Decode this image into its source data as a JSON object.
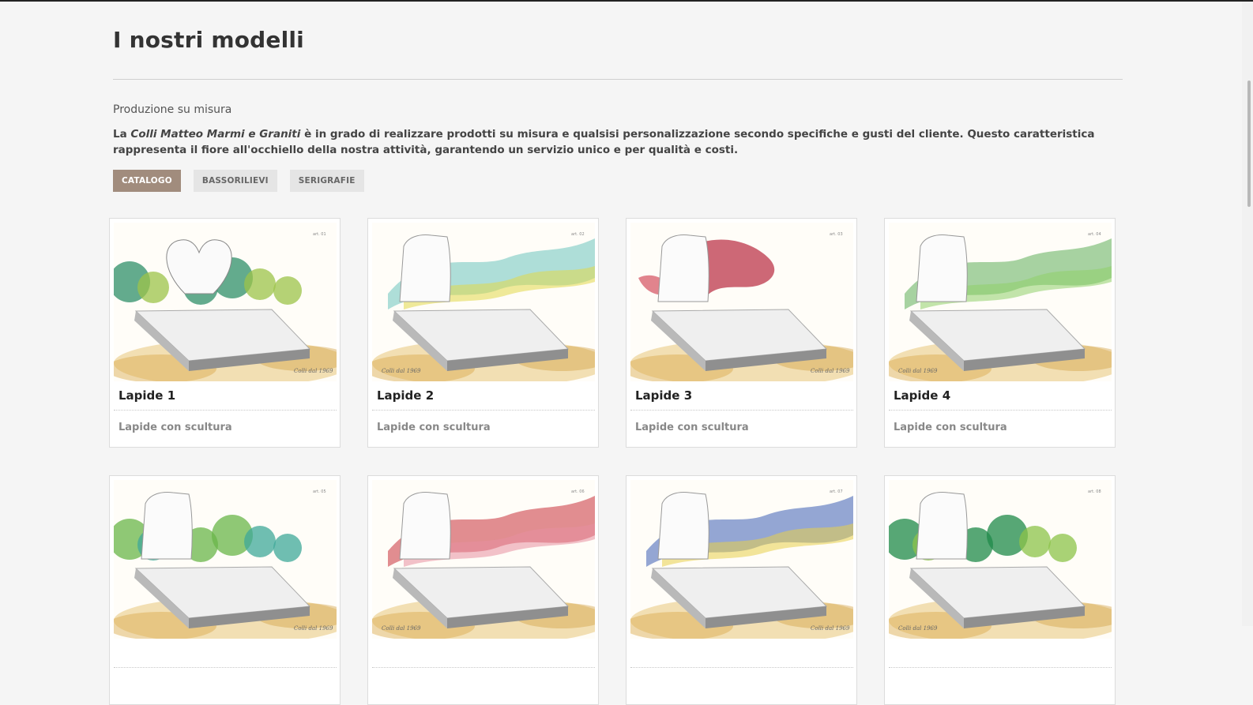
{
  "page": {
    "title": "I nostri modelli",
    "subtitle": "Produzione su misura",
    "intro_prefix": "La ",
    "intro_company": "Colli Matteo Marmi e Graniti",
    "intro_rest": " è in grado di realizzare prodotti su misura e qualsisi personalizzazione secondo specifiche e gusti del cliente. Questo caratteristica rappresenta il fiore all'occhiello della nostra attività, garantendo un servizio unico e per qualità e costi."
  },
  "filters": [
    {
      "label": "CATALOGO",
      "active": true
    },
    {
      "label": "BASSORILIEVI",
      "active": false
    },
    {
      "label": "SERIGRAFIE",
      "active": false
    }
  ],
  "products": [
    {
      "name": "Lapide 1",
      "desc": "Lapide con scultura",
      "art": "art. 01",
      "accent": "#2f8f6a",
      "accent2": "#9cc34a",
      "shape": "heart"
    },
    {
      "name": "Lapide 2",
      "desc": "Lapide con scultura",
      "art": "art. 02",
      "accent": "#6cc4bd",
      "accent2": "#e2d84b",
      "shape": "wave"
    },
    {
      "name": "Lapide 3",
      "desc": "Lapide con scultura",
      "art": "art. 03",
      "accent": "#b8283e",
      "accent2": "#d45060",
      "shape": "flame"
    },
    {
      "name": "Lapide 4",
      "desc": "Lapide con scultura",
      "art": "art. 04",
      "accent": "#5fae5a",
      "accent2": "#8fcf6a",
      "shape": "wave"
    },
    {
      "name": "",
      "desc": "",
      "art": "art. 05",
      "accent": "#6ab64a",
      "accent2": "#3fa89a",
      "shape": "bush"
    },
    {
      "name": "",
      "desc": "",
      "art": "art. 06",
      "accent": "#c8323a",
      "accent2": "#e890a0",
      "shape": "wave"
    },
    {
      "name": "",
      "desc": "",
      "art": "art. 07",
      "accent": "#3c5eb4",
      "accent2": "#e8cf4a",
      "shape": "wave"
    },
    {
      "name": "",
      "desc": "",
      "art": "art. 08",
      "accent": "#1f8a4a",
      "accent2": "#8cc34a",
      "shape": "bush"
    }
  ],
  "signature": "Colli dal 1969"
}
